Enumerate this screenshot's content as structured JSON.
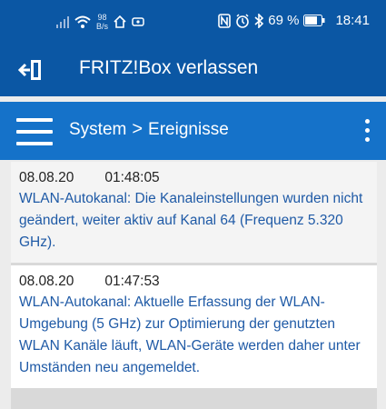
{
  "status_bar": {
    "speed_value": "98",
    "speed_unit": "B/s",
    "battery": "69 %",
    "time": "18:41"
  },
  "app_bar": {
    "title": "FRITZ!Box verlassen",
    "icon": "exit-icon"
  },
  "nav_bar": {
    "section": "System",
    "separator": ">",
    "page": "Ereignisse"
  },
  "events": [
    {
      "date": "08.08.20",
      "time": "01:48:05",
      "message": "WLAN-Autokanal: Die Kanaleinstellungen wurden nicht geändert, weiter aktiv auf Kanal 64 (Frequenz 5.320 GHz)."
    },
    {
      "date": "08.08.20",
      "time": "01:47:53",
      "message": "WLAN-Autokanal: Aktuelle Erfassung der WLAN-Umgebung (5 GHz) zur Optimierung der genutzten WLAN Kanäle läuft, WLAN-Geräte werden daher unter Umständen neu angemeldet."
    }
  ],
  "colors": {
    "status_bg": "#0b57a4",
    "nav_bg": "#1572c9",
    "link_text": "#1f5aa6"
  }
}
